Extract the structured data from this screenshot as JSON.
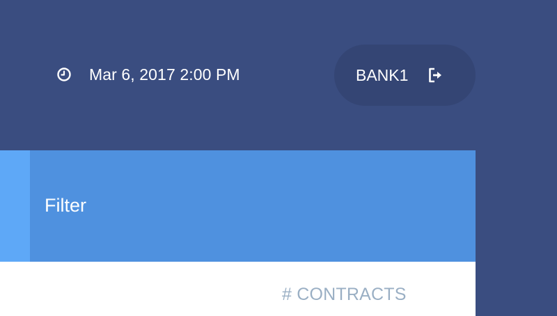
{
  "header": {
    "datetime": "Mar 6, 2017 2:00 PM",
    "clock_icon": "clock-icon",
    "user": {
      "name": "BANK1",
      "logout_icon": "logout-icon"
    }
  },
  "filter": {
    "title": "Filter"
  },
  "table": {
    "columns": [
      "# CONTRACTS"
    ]
  },
  "colors": {
    "background": "#3a4d80",
    "user_pill": "#344574",
    "filter_panel": "#4f91df",
    "filter_accent": "#5ea8f7",
    "column_header": "#9aafc4"
  }
}
